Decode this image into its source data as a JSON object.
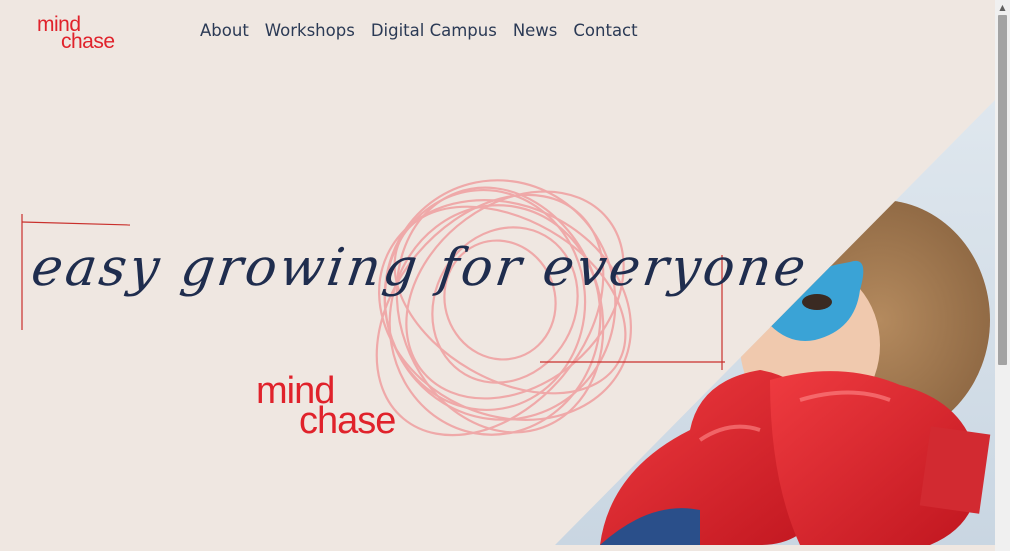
{
  "brand": {
    "line1": "mind",
    "line2": "chase",
    "color": "#e0222b"
  },
  "nav": {
    "items": [
      {
        "label": "About"
      },
      {
        "label": "Workshops"
      },
      {
        "label": "Digital Campus"
      },
      {
        "label": "News"
      },
      {
        "label": "Contact"
      }
    ]
  },
  "hero": {
    "tagline": "easy growing for everyone",
    "logo_line1": "mind",
    "logo_line2": "chase",
    "image_alt_icon": "child-superhero-boxing-photo",
    "scribble_color": "#f0a3a3",
    "text_color": "#1f2d4e"
  },
  "scrollbar": {
    "up_icon": "chevron-up-icon"
  }
}
